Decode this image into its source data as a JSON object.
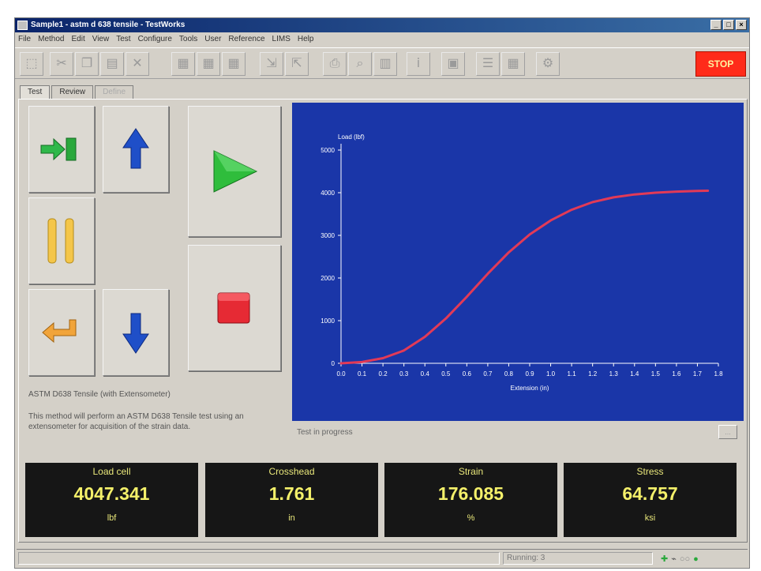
{
  "window": {
    "title": "Sample1 - astm d 638 tensile - TestWorks"
  },
  "menu": [
    "File",
    "Method",
    "Edit",
    "View",
    "Test",
    "Configure",
    "Tools",
    "User",
    "Reference",
    "LIMS",
    "Help"
  ],
  "toolbar": {
    "stop_label": "STOP"
  },
  "tabs": [
    {
      "label": "Test"
    },
    {
      "label": "Review"
    },
    {
      "label": "Define"
    }
  ],
  "description": {
    "title": "ASTM D638 Tensile (with Extensometer)",
    "body": "This method will perform an ASTM D638 Tensile test using an extensometer for acquisition of the strain data."
  },
  "status": {
    "message": "Test in progress",
    "small_button": "..."
  },
  "readouts": [
    {
      "label": "Load cell",
      "value": "4047.341",
      "unit": "lbf"
    },
    {
      "label": "Crosshead",
      "value": "1.761",
      "unit": "in"
    },
    {
      "label": "Strain",
      "value": "176.085",
      "unit": "%"
    },
    {
      "label": "Stress",
      "value": "64.757",
      "unit": "ksi"
    }
  ],
  "statusbar": {
    "running": "Running: 3"
  },
  "chart_data": {
    "type": "line",
    "title": "",
    "xlabel": "Extension (in)",
    "ylabel": "Load (lbf)",
    "xlim": [
      0,
      1.8
    ],
    "ylim": [
      0,
      5000
    ],
    "x_ticks": [
      "0.0",
      "0.1",
      "0.2",
      "0.3",
      "0.4",
      "0.5",
      "0.6",
      "0.7",
      "0.8",
      "0.9",
      "1.0",
      "1.1",
      "1.2",
      "1.3",
      "1.4",
      "1.5",
      "1.6",
      "1.7",
      "1.8"
    ],
    "y_ticks": [
      "0",
      "1000",
      "2000",
      "3000",
      "4000",
      "5000"
    ],
    "grid": false,
    "colors": {
      "background": "#1a36a8",
      "line": "#e23a57",
      "axis": "#ffffff"
    },
    "series": [
      {
        "x": [
          0.0,
          0.1,
          0.2,
          0.3,
          0.4,
          0.5,
          0.6,
          0.7,
          0.8,
          0.9,
          1.0,
          1.1,
          1.2,
          1.3,
          1.4,
          1.5,
          1.6,
          1.7,
          1.75
        ],
        "y": [
          0,
          30,
          120,
          300,
          620,
          1050,
          1560,
          2100,
          2600,
          3020,
          3350,
          3600,
          3780,
          3890,
          3960,
          4000,
          4025,
          4040,
          4047
        ]
      }
    ]
  },
  "icons": {
    "enter": "arrow-into-bar",
    "up": "arrow-up",
    "pause": "pause",
    "return": "return-arrow",
    "down": "arrow-down",
    "start": "play-triangle",
    "stop": "stop-square"
  }
}
